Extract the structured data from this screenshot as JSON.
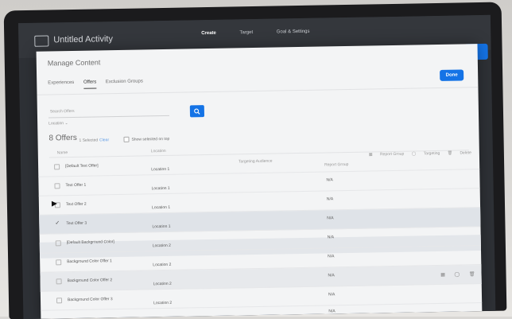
{
  "app": {
    "title": "Untitled Activity",
    "steps": [
      "Create",
      "Target",
      "Goal & Settings"
    ]
  },
  "modal": {
    "title": "Manage Content",
    "tabs": [
      "Experiences",
      "Offers",
      "Exclusion Groups"
    ],
    "active_tab": "Offers",
    "done_label": "Done",
    "search_placeholder": "Search Offers",
    "location_filter": "Location",
    "count_label": "8 Offers",
    "selected_label": "1 Selected",
    "clear_label": "Clear",
    "show_top_label": "Show selected on top",
    "actions": [
      "Report Group",
      "Targeting",
      "Delete"
    ],
    "columns": {
      "name": "Name",
      "location": "Location",
      "audience": "Targeting Audience",
      "group": "Report Group"
    },
    "rows": [
      {
        "name": "[Default Text Offer]",
        "location": "Location 1",
        "group": ""
      },
      {
        "name": "Text Offer 1",
        "location": "Location 1",
        "group": "N/A"
      },
      {
        "name": "Text Offer 2",
        "location": "Location 1",
        "group": "N/A"
      },
      {
        "name": "Text Offer 3",
        "location": "Location 1",
        "group": "N/A",
        "selected": true
      },
      {
        "name": "[Default Background Color]",
        "location": "Location 2",
        "group": "N/A"
      },
      {
        "name": "Background Color Offer 1",
        "location": "Location 2",
        "group": "N/A"
      },
      {
        "name": "Background Color Offer 2",
        "location": "Location 2",
        "group": "N/A"
      },
      {
        "name": "Background Color Offer 3",
        "location": "Location 2",
        "group": "N/A"
      }
    ],
    "trailing_group": "N/A",
    "row_icons": [
      "report-group-icon",
      "targeting-icon",
      "delete-icon"
    ]
  },
  "colors": {
    "accent": "#1473e6",
    "modal_bg": "#f3f4f5",
    "selected_row": "#dfe3e8"
  }
}
